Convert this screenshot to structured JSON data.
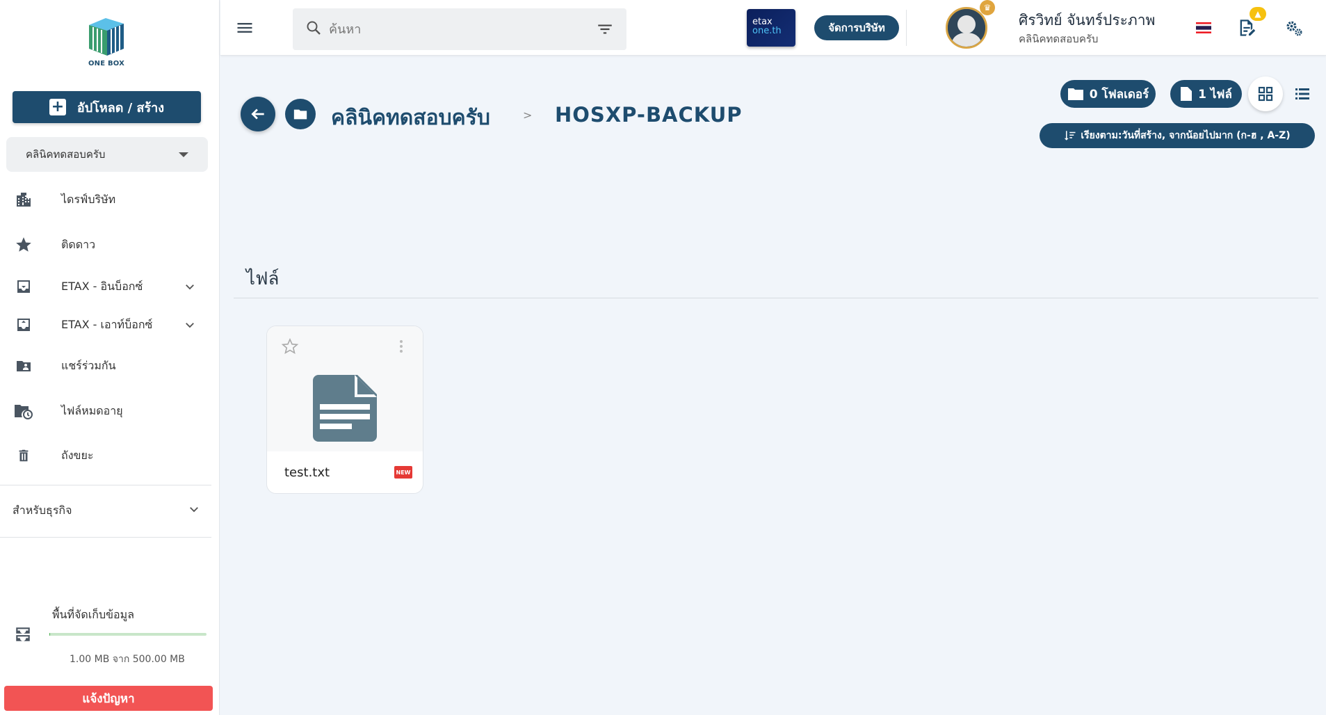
{
  "sidebar": {
    "logo_text": "ONE BOX",
    "upload_label": "อัปโหลด / สร้าง",
    "company_select": "คลินิคทดสอบครับ",
    "items": [
      {
        "label": "ไดรฟ์บริษัท",
        "icon": "building-icon"
      },
      {
        "label": "ติดดาว",
        "icon": "star-icon"
      },
      {
        "label": "ETAX - อินบ็อกซ์",
        "icon": "inbox-in-icon"
      },
      {
        "label": "ETAX - เอาท์บ็อกซ์",
        "icon": "inbox-out-icon"
      },
      {
        "label": "แชร์ร่วมกัน",
        "icon": "shared-folder-icon"
      },
      {
        "label": "ไฟล์หมดอายุ",
        "icon": "folder-clock-icon"
      },
      {
        "label": "ถังขยะ",
        "icon": "trash-icon"
      }
    ],
    "business_label": "สำหรับธุรกิจ",
    "storage": {
      "title": "พื้นที่จัดเก็บข้อมูล",
      "usage_text": "1.00 MB จาก 500.00 MB",
      "used_fraction": 0.002
    },
    "report_label": "แจ้งปัญหา"
  },
  "topbar": {
    "search_placeholder": "ค้นหา",
    "etax_line1": "etax",
    "etax_line2": "one.th",
    "manage_label": "จัดการบริษัท",
    "user_name": "ศิรวิทย์ จันทร์ประภาพ",
    "user_org": "คลินิคทดสอบครับ"
  },
  "breadcrumb": {
    "parent": "คลินิคทดสอบครับ",
    "separator": ">",
    "current": "HOSXP-BACKUP"
  },
  "counts": {
    "folders": "0 โฟลเดอร์",
    "files": "1 ไฟล์"
  },
  "sort_label": "เรียงตาม:วันที่สร้าง, จากน้อยไปมาก (ก-ฮ , A-Z)",
  "files_section": {
    "title": "ไฟล์",
    "files": [
      {
        "name": "test.txt",
        "badge": "NEW"
      }
    ]
  },
  "colors": {
    "primary": "#1e4c6e",
    "report": "#f25454",
    "new_badge": "#e53935",
    "doc_icon": "#5f7d8c"
  }
}
